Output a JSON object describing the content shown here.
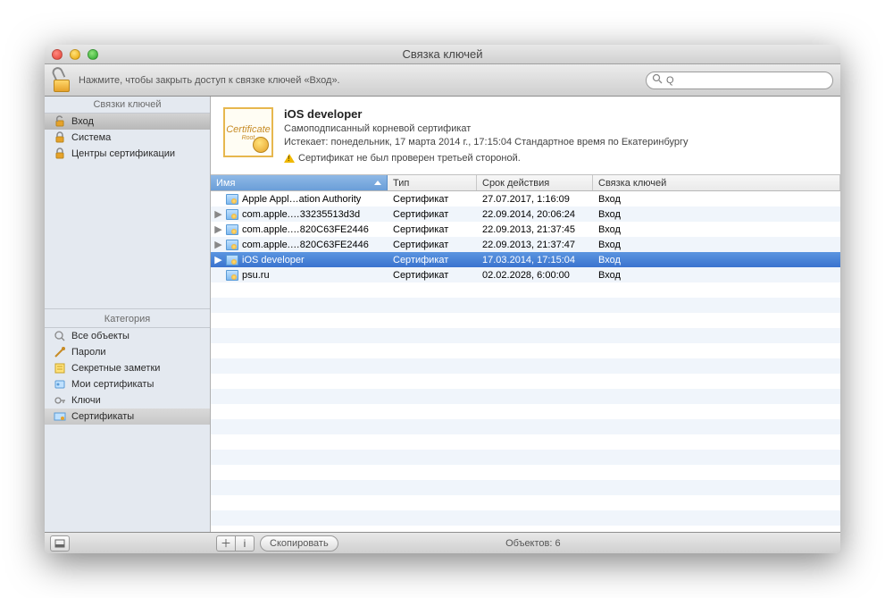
{
  "window": {
    "title": "Связка ключей"
  },
  "toolbar": {
    "lock_text": "Нажмите, чтобы закрыть доступ к связке ключей «Вход».",
    "search_placeholder": "Q"
  },
  "sidebar": {
    "keychains_title": "Связки ключей",
    "keychains": [
      {
        "label": "Вход",
        "icon": "unlock-icon",
        "selected": true
      },
      {
        "label": "Система",
        "icon": "lock-icon",
        "selected": false
      },
      {
        "label": "Центры сертификации",
        "icon": "lock-icon",
        "selected": false
      }
    ],
    "category_title": "Категория",
    "categories": [
      {
        "label": "Все объекты",
        "icon": "search-icon",
        "selected": false
      },
      {
        "label": "Пароли",
        "icon": "key-pen-icon",
        "selected": false
      },
      {
        "label": "Секретные заметки",
        "icon": "note-icon",
        "selected": false
      },
      {
        "label": "Мои сертификаты",
        "icon": "badge-icon",
        "selected": false
      },
      {
        "label": "Ключи",
        "icon": "key-icon",
        "selected": false
      },
      {
        "label": "Сертификаты",
        "icon": "certificate-icon",
        "selected": true
      }
    ]
  },
  "detail": {
    "title": "iOS developer",
    "subtitle": "Самоподписанный корневой сертификат",
    "expires": "Истекает: понедельник, 17 марта 2014 г., 17:15:04 Стандартное время по Екатеринбургу",
    "warning": "Сертификат не был проверен третьей стороной.",
    "badge_text": "Certificate",
    "badge_sub": "Root"
  },
  "table": {
    "columns": {
      "name": "Имя",
      "type": "Тип",
      "expires": "Срок действия",
      "keychain": "Связка ключей"
    },
    "rows": [
      {
        "name": "Apple Appl…ation Authority",
        "type": "Сертификат",
        "expires": "27.07.2017, 1:16:09",
        "keychain": "Вход",
        "has_children": false,
        "selected": false
      },
      {
        "name": "com.apple.…33235513d3d",
        "type": "Сертификат",
        "expires": "22.09.2014, 20:06:24",
        "keychain": "Вход",
        "has_children": true,
        "selected": false
      },
      {
        "name": "com.apple.…820C63FE2446",
        "type": "Сертификат",
        "expires": "22.09.2013, 21:37:45",
        "keychain": "Вход",
        "has_children": true,
        "selected": false
      },
      {
        "name": "com.apple.…820C63FE2446",
        "type": "Сертификат",
        "expires": "22.09.2013, 21:37:47",
        "keychain": "Вход",
        "has_children": true,
        "selected": false
      },
      {
        "name": "iOS developer",
        "type": "Сертификат",
        "expires": "17.03.2014, 17:15:04",
        "keychain": "Вход",
        "has_children": true,
        "selected": true
      },
      {
        "name": "psu.ru",
        "type": "Сертификат",
        "expires": "02.02.2028, 6:00:00",
        "keychain": "Вход",
        "has_children": false,
        "selected": false
      }
    ]
  },
  "statusbar": {
    "copy_label": "Скопировать",
    "count_label": "Объектов: 6"
  }
}
